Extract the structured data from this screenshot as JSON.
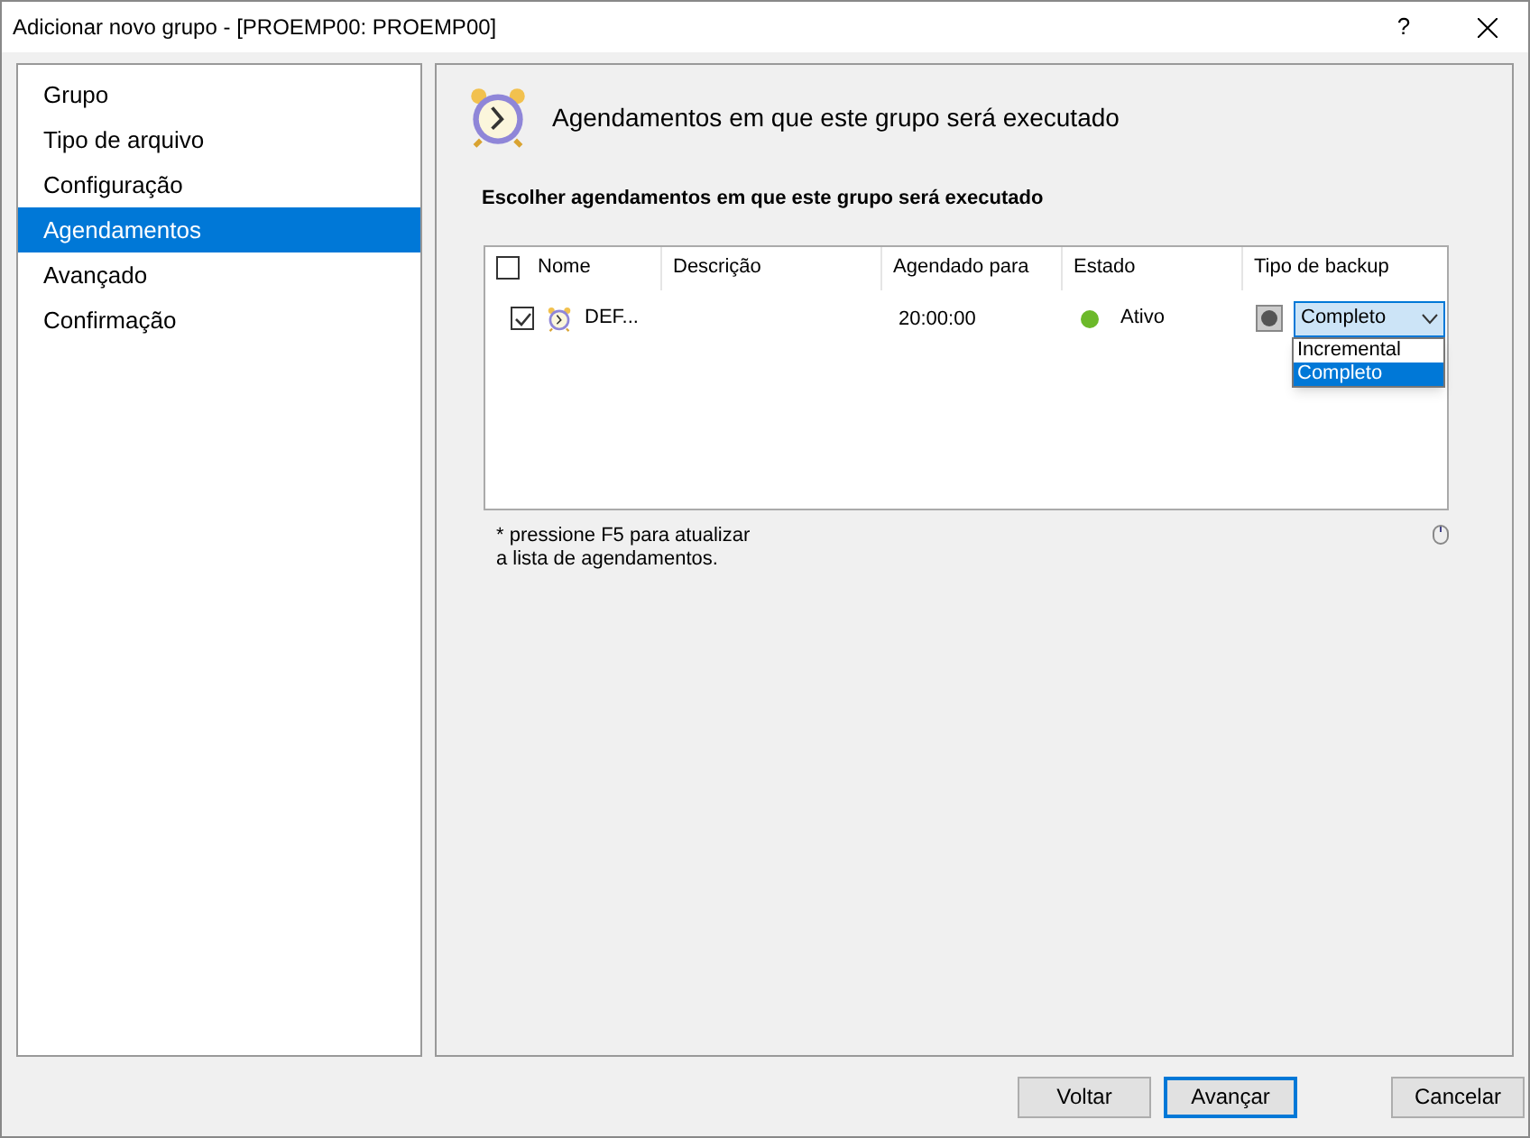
{
  "window": {
    "title": "Adicionar novo grupo - [PROEMP00: PROEMP00]",
    "help": "?"
  },
  "sidebar": {
    "items": [
      {
        "label": "Grupo",
        "selected": false
      },
      {
        "label": "Tipo de arquivo",
        "selected": false
      },
      {
        "label": "Configuração",
        "selected": false
      },
      {
        "label": "Agendamentos",
        "selected": true
      },
      {
        "label": "Avançado",
        "selected": false
      },
      {
        "label": "Confirmação",
        "selected": false
      }
    ]
  },
  "header": {
    "title": "Agendamentos em que este grupo será executado"
  },
  "section_label": "Escolher agendamentos em que este grupo será executado",
  "table": {
    "all_checked": false,
    "columns": [
      "Nome",
      "Descrição",
      "Agendado para",
      "Estado",
      "Tipo de backup"
    ],
    "rows": [
      {
        "checked": true,
        "name": "DEF...",
        "scheduled": "20:00:00",
        "status": "Ativo",
        "color": "#6cb92a",
        "backup_type": "Completo",
        "dropdown_open": true,
        "options": [
          {
            "label": "Incremental",
            "selected": false
          },
          {
            "label": "Completo",
            "selected": true
          }
        ]
      }
    ]
  },
  "note_lines": [
    "* pressione F5 para atualizar",
    "a lista de agendamentos."
  ],
  "buttons": [
    {
      "label": "Voltar",
      "focused": false
    },
    {
      "label": "Avançar",
      "focused": true
    },
    {
      "label": "Cancelar",
      "focused": false
    }
  ]
}
